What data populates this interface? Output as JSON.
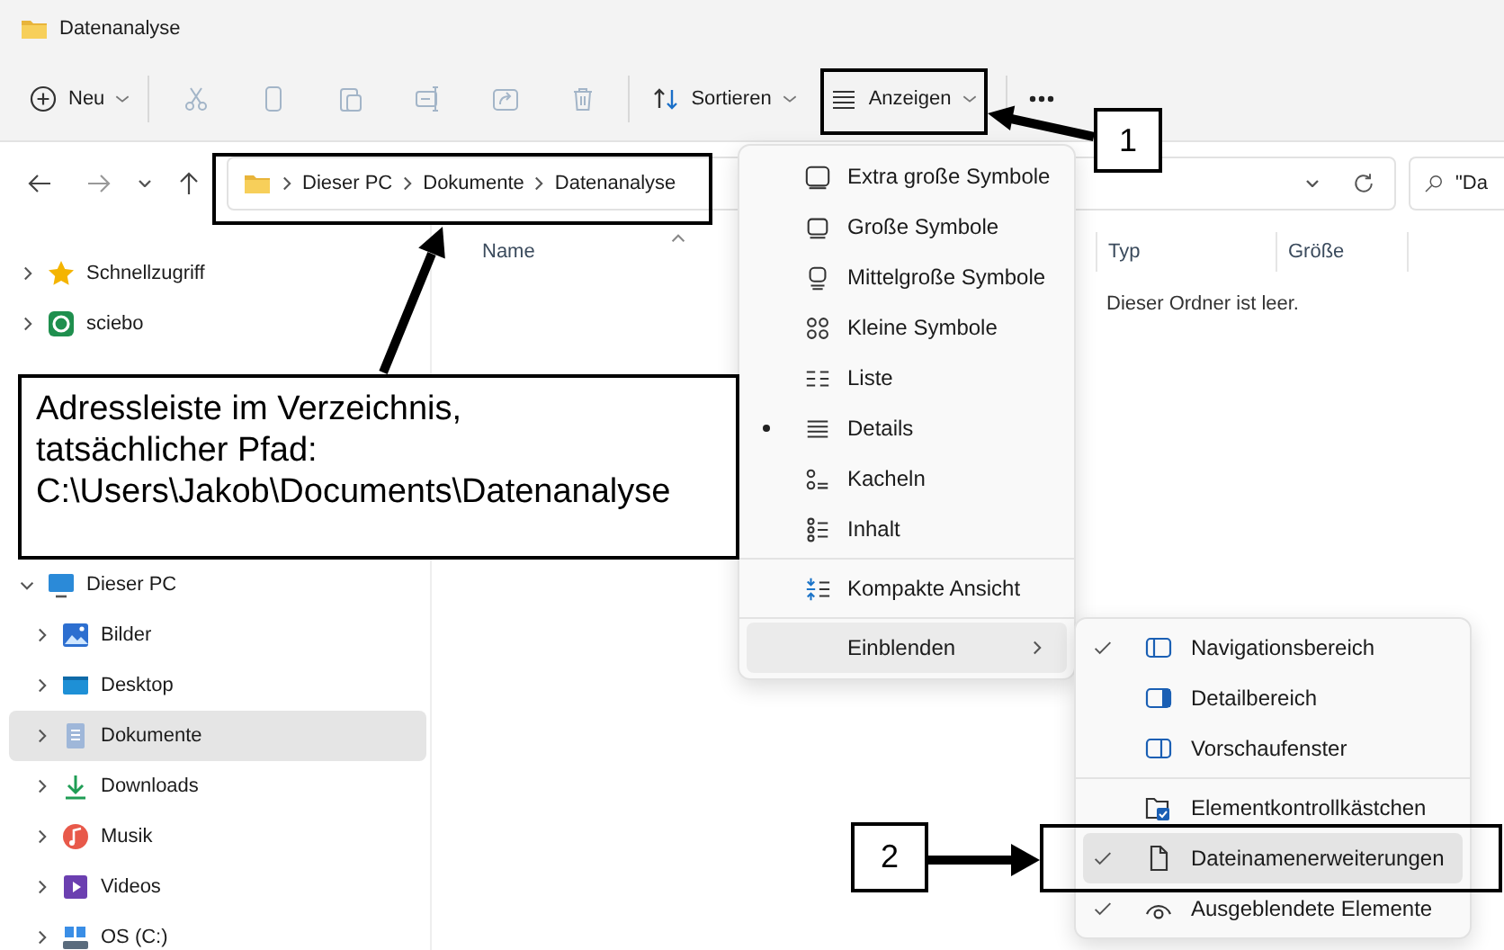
{
  "window": {
    "title": "Datenanalyse"
  },
  "toolbar": {
    "new_label": "Neu",
    "actions": [
      {
        "disabled": true
      },
      {
        "disabled": true
      },
      {
        "disabled": true
      },
      {
        "disabled": true
      },
      {
        "disabled": true
      },
      {
        "disabled": true
      }
    ],
    "sort_label": "Sortieren",
    "view_label": "Anzeigen"
  },
  "address_bar": {
    "path": [
      "Dieser PC",
      "Dokumente",
      "Datenanalyse"
    ]
  },
  "search": {
    "value": "\"Da"
  },
  "sidebar": {
    "items": [
      {
        "label": "Schnellzugriff",
        "expanded": false,
        "selected": false
      },
      {
        "label": "sciebo",
        "expanded": false,
        "selected": false
      },
      {
        "label": "Dieser PC",
        "expanded": true,
        "selected": false,
        "children": [
          {
            "label": "Bilder",
            "expanded": false,
            "selected": false
          },
          {
            "label": "Desktop",
            "expanded": false,
            "selected": false
          },
          {
            "label": "Dokumente",
            "expanded": false,
            "selected": true
          },
          {
            "label": "Downloads",
            "expanded": false,
            "selected": false
          },
          {
            "label": "Musik",
            "expanded": false,
            "selected": false
          },
          {
            "label": "Videos",
            "expanded": false,
            "selected": false
          },
          {
            "label": "OS (C:)",
            "expanded": false,
            "selected": false
          }
        ]
      }
    ]
  },
  "file_list": {
    "columns": [
      "Name",
      "Typ",
      "Größe"
    ],
    "empty_message": "Dieser Ordner ist leer."
  },
  "view_menu": {
    "layouts": [
      {
        "label": "Extra große Symbole",
        "selected": false
      },
      {
        "label": "Große Symbole",
        "selected": false
      },
      {
        "label": "Mittelgroße Symbole",
        "selected": false
      },
      {
        "label": "Kleine Symbole",
        "selected": false
      },
      {
        "label": "Liste",
        "selected": false
      },
      {
        "label": "Details",
        "selected": true
      },
      {
        "label": "Kacheln",
        "selected": false
      },
      {
        "label": "Inhalt",
        "selected": false
      }
    ],
    "compact": {
      "label": "Kompakte Ansicht"
    },
    "show": {
      "label": "Einblenden",
      "expanded": true
    }
  },
  "show_menu": {
    "groups": [
      [
        {
          "label": "Navigationsbereich",
          "checked": true,
          "hovered": false
        },
        {
          "label": "Detailbereich",
          "checked": false,
          "hovered": false
        },
        {
          "label": "Vorschaufenster",
          "checked": false,
          "hovered": false
        }
      ],
      [
        {
          "label": "Elementkontrollkästchen",
          "checked": false,
          "hovered": false
        },
        {
          "label": "Dateinamenerweiterungen",
          "checked": true,
          "hovered": true
        },
        {
          "label": "Ausgeblendete Elemente",
          "checked": true,
          "hovered": false
        }
      ]
    ]
  },
  "annotations": {
    "callout": {
      "lines": [
        "Adressleiste im Verzeichnis,",
        "tatsächlicher Pfad:",
        "C:\\Users\\Jakob\\Documents\\Datenanalyse"
      ]
    },
    "markers": [
      {
        "text": "1"
      },
      {
        "text": "2"
      }
    ]
  }
}
